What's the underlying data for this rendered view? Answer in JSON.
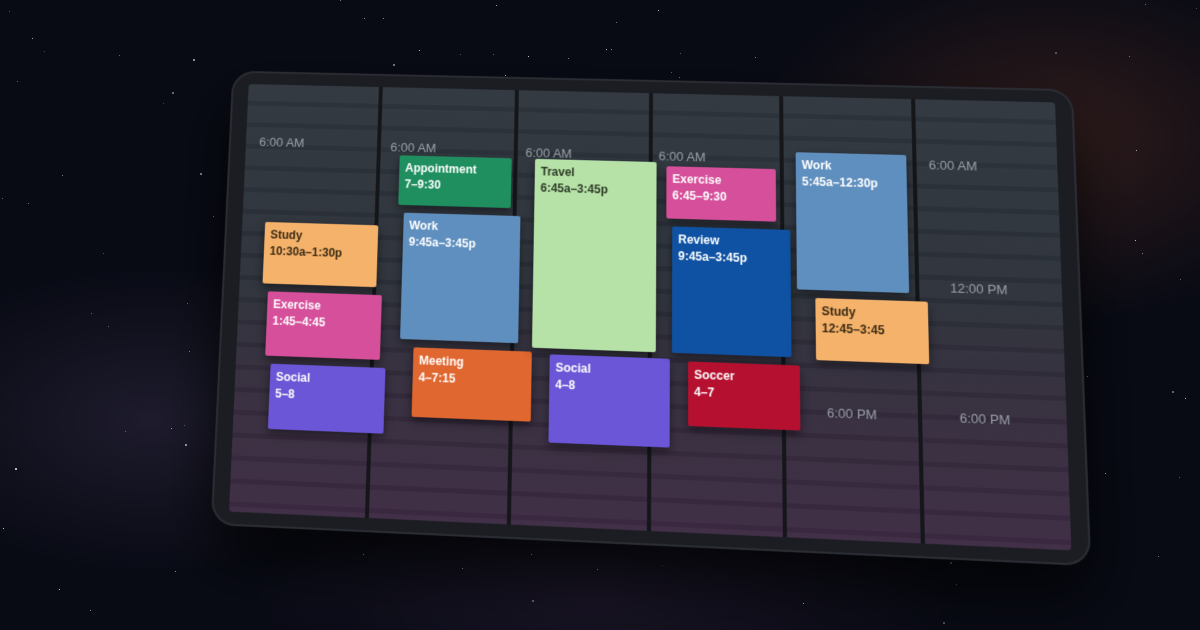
{
  "time_labels": {
    "six_am": "6:00 AM",
    "noon": "12:00 PM",
    "six_pm": "6:00 PM"
  },
  "days": [
    {
      "events": [
        {
          "title": "Study",
          "time": "10:30a–1:30p",
          "color": "#f5b26b",
          "text_color": "#3a2a12"
        },
        {
          "title": "Exercise",
          "time": "1:45–4:45",
          "color": "#d64f9a",
          "text_color": "#ffffff"
        },
        {
          "title": "Social",
          "time": "5–8",
          "color": "#6a56d6",
          "text_color": "#ffffff"
        }
      ]
    },
    {
      "events": [
        {
          "title": "Appointment",
          "time": "7–9:30",
          "color": "#1f8f5f",
          "text_color": "#ffffff"
        },
        {
          "title": "Work",
          "time": "9:45a–3:45p",
          "color": "#5f8fbf",
          "text_color": "#ffffff"
        },
        {
          "title": "Meeting",
          "time": "4–7:15",
          "color": "#e0672f",
          "text_color": "#ffffff"
        }
      ]
    },
    {
      "events": [
        {
          "title": "Travel",
          "time": "6:45a–3:45p",
          "color": "#b6e2a8",
          "text_color": "#2c3a26"
        },
        {
          "title": "Social",
          "time": "4–8",
          "color": "#6a56d6",
          "text_color": "#ffffff"
        }
      ]
    },
    {
      "events": [
        {
          "title": "Exercise",
          "time": "6:45–9:30",
          "color": "#d64f9a",
          "text_color": "#ffffff"
        },
        {
          "title": "Review",
          "time": "9:45a–3:45p",
          "color": "#0f52a3",
          "text_color": "#ffffff"
        },
        {
          "title": "Soccer",
          "time": "4–7",
          "color": "#b5102f",
          "text_color": "#ffffff"
        }
      ]
    },
    {
      "events": [
        {
          "title": "Work",
          "time": "5:45a–12:30p",
          "color": "#5f8fbf",
          "text_color": "#ffffff"
        },
        {
          "title": "Study",
          "time": "12:45–3:45",
          "color": "#f5b26b",
          "text_color": "#3a2a12"
        }
      ]
    }
  ]
}
